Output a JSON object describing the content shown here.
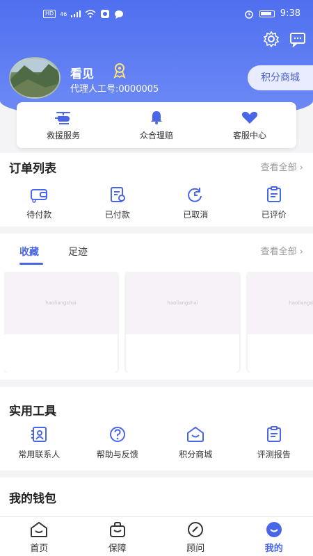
{
  "status_bar": {
    "time": "9:38",
    "network_label": "46",
    "hd_label": "HD"
  },
  "profile": {
    "username": "看见",
    "agent_number": "代理人工号:0000005",
    "points_mall_button": "积分商城"
  },
  "services": [
    {
      "label": "救援服务",
      "icon": "helicopter-icon"
    },
    {
      "label": "众合理赔",
      "icon": "bell-icon"
    },
    {
      "label": "客服中心",
      "icon": "heart-icon"
    }
  ],
  "orders": {
    "title": "订单列表",
    "view_all": "查看全部",
    "items": [
      {
        "label": "待付款",
        "icon": "wallet-icon"
      },
      {
        "label": "已付款",
        "icon": "paid-icon"
      },
      {
        "label": "已取消",
        "icon": "refresh-icon"
      },
      {
        "label": "已评价",
        "icon": "review-icon"
      }
    ]
  },
  "favorites": {
    "tabs": [
      "收藏",
      "足迹"
    ],
    "active_tab": "收藏",
    "view_all": "查看全部",
    "watermark": "haoliangshai"
  },
  "tools": {
    "title": "实用工具",
    "items": [
      {
        "label": "常用联系人",
        "icon": "contact-icon"
      },
      {
        "label": "帮助与反馈",
        "icon": "help-icon"
      },
      {
        "label": "积分商城",
        "icon": "mall-icon"
      },
      {
        "label": "评测报告",
        "icon": "report-icon"
      }
    ]
  },
  "wallet": {
    "title": "我的钱包"
  },
  "bottom_nav": {
    "items": [
      "首页",
      "保障",
      "顾问",
      "我的"
    ],
    "active": "我的"
  },
  "colors": {
    "primary": "#4a66e8",
    "header": "#5a78f2"
  }
}
